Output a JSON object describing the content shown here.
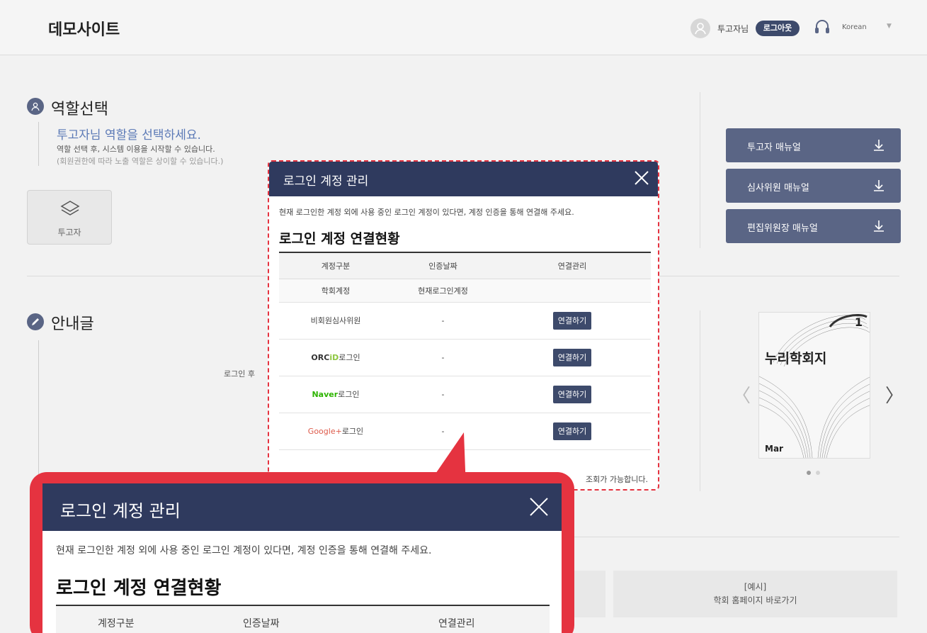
{
  "header": {
    "site_title": "데모사이트",
    "user_name": "투고자님",
    "logout_label": "로그아웃",
    "language": "Korean"
  },
  "role": {
    "title": "역할선택",
    "lead": "투고자님 역할을 선택하세요.",
    "desc1": "역할 선택 후, 시스템 이용을 시작할 수 있습니다.",
    "desc2": "(회원권한에 따라 노출 역할은 상이할 수 있습니다.)",
    "card_label": "투고자"
  },
  "manuals": [
    {
      "label": "투고자 매뉴얼"
    },
    {
      "label": "심사위원 매뉴얼"
    },
    {
      "label": "편집위원장 매뉴얼"
    }
  ],
  "notice": {
    "title": "안내글",
    "text": "로그인 후"
  },
  "journal": {
    "issue": "1",
    "title": "누리학회지",
    "month": "Mar"
  },
  "quick_links": {
    "link2_line1": "[예시]",
    "link2_line2": "학회 홈페이지 바로가기"
  },
  "modal": {
    "title": "로그인 계정 관리",
    "description": "현재 로그인한 계정 외에 사용 중인 로그인 계정이 있다면, 계정 인증을 통해 연결해 주세요.",
    "subtitle": "로그인 계정 연결현황",
    "columns": [
      "계정구분",
      "인증날짜",
      "연결관리"
    ],
    "rows": [
      {
        "type": "학회계정",
        "date": "현재로그인계정",
        "action": ""
      },
      {
        "type": "비회원심사위원",
        "date": "-",
        "action": "연결하기"
      },
      {
        "type_a": "ORC",
        "type_b": "iD",
        "type_c": "로그인",
        "date": "-",
        "action": "연결하기"
      },
      {
        "type_a": "Naver",
        "type_c": "로그인",
        "date": "-",
        "action": "연결하기"
      },
      {
        "type_a": "Google+",
        "type_c": "로그인",
        "date": "-",
        "action": "연결하기"
      }
    ],
    "footer": "조회가 가능합니다."
  },
  "colors": {
    "navy": "#2f3a5e",
    "button": "#3d4a6b",
    "highlight_red": "#e53340"
  }
}
